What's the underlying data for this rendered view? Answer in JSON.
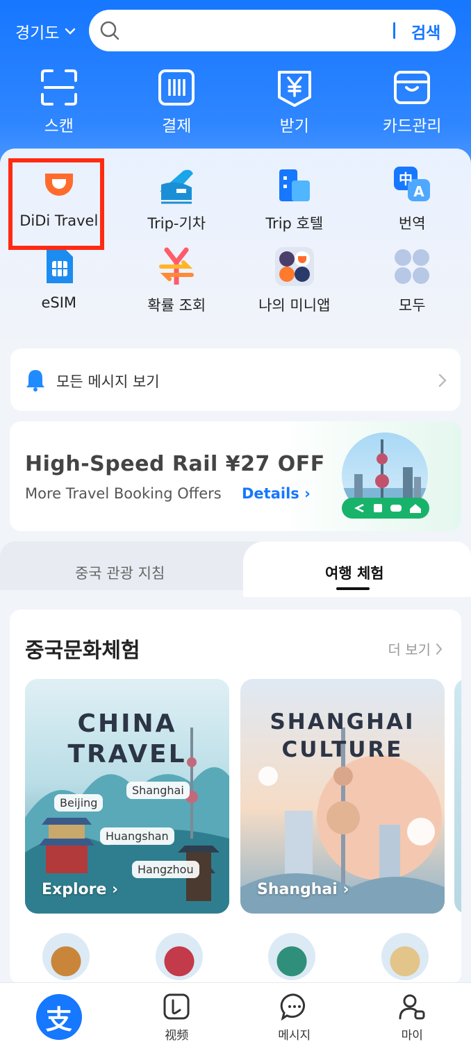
{
  "header": {
    "region": "경기도",
    "search_button": "검색"
  },
  "quick_actions": [
    {
      "label": "스캔",
      "icon": "scan-icon"
    },
    {
      "label": "결제",
      "icon": "barcode-pay-icon"
    },
    {
      "label": "받기",
      "icon": "yuan-receive-icon"
    },
    {
      "label": "카드관리",
      "icon": "wallet-card-icon"
    }
  ],
  "services": [
    {
      "label": "DiDi Travel",
      "icon": "didi-icon"
    },
    {
      "label": "Trip-기차",
      "icon": "train-icon"
    },
    {
      "label": "Trip 호텔",
      "icon": "hotel-icon"
    },
    {
      "label": "번역",
      "icon": "translate-icon"
    },
    {
      "label": "eSIM",
      "icon": "esim-icon"
    },
    {
      "label": "확률 조회",
      "icon": "exchange-rate-icon"
    },
    {
      "label": "나의 미니앱",
      "icon": "my-mini-apps-icon"
    },
    {
      "label": "모두",
      "icon": "all-apps-icon"
    }
  ],
  "messages": {
    "label": "모든 메시지 보기"
  },
  "banner": {
    "title": "High-Speed Rail ¥27 OFF",
    "subtitle": "More Travel Booking Offers",
    "link": "Details ›"
  },
  "tabs": {
    "guide": "중국 관광 지침",
    "experience": "여행 체험"
  },
  "culture": {
    "heading": "중국문화체험",
    "more": "더 보기",
    "tiles": [
      {
        "title_line1": "CHINA",
        "title_line2": "TRAVEL",
        "tags": [
          "Shanghai",
          "Beijing",
          "Huangshan",
          "Hangzhou"
        ],
        "cta": "Explore ›"
      },
      {
        "title_line1": "SHANGHAI",
        "title_line2": "CULTURE",
        "tags": [],
        "cta": "Shanghai ›"
      }
    ]
  },
  "bottom_nav": [
    {
      "label": "",
      "icon": "alipay-home-icon"
    },
    {
      "label": "视频",
      "icon": "video-icon"
    },
    {
      "label": "메시지",
      "icon": "message-icon"
    },
    {
      "label": "마이",
      "icon": "profile-icon"
    }
  ],
  "colors": {
    "brand_blue": "#1677ff",
    "didi_orange": "#ff6b2c",
    "highlight_red": "#ff2a12",
    "rail_green": "#18b36a"
  }
}
